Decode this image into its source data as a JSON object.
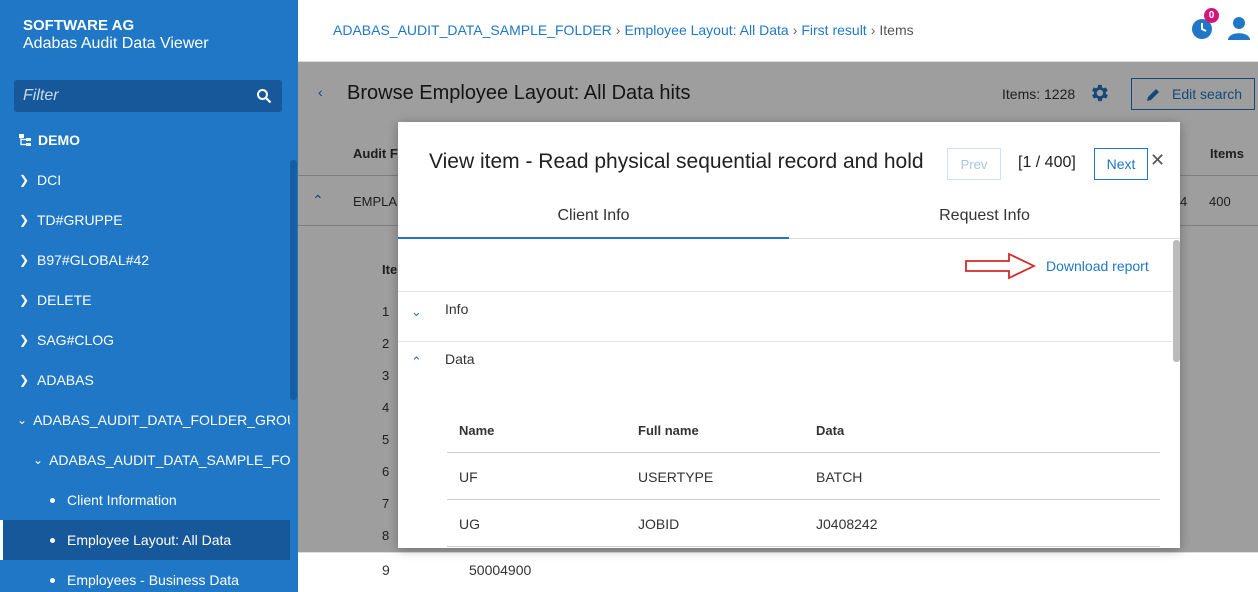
{
  "sidebar": {
    "brand_line1": "SOFTWARE AG",
    "brand_line2": "Adabas Audit Data Viewer",
    "filter_placeholder": "Filter",
    "items": [
      {
        "label": "DEMO"
      },
      {
        "label": "DCI"
      },
      {
        "label": "TD#GRUPPE"
      },
      {
        "label": "B97#GLOBAL#42"
      },
      {
        "label": "DELETE"
      },
      {
        "label": "SAG#CLOG"
      },
      {
        "label": "ADABAS"
      },
      {
        "label": "ADABAS_AUDIT_DATA_FOLDER_GROUP"
      },
      {
        "label": "ADABAS_AUDIT_DATA_SAMPLE_FO..."
      },
      {
        "label": "Client Information"
      },
      {
        "label": "Employee Layout: All Data"
      },
      {
        "label": "Employees - Business Data"
      }
    ]
  },
  "header": {
    "breadcrumb": [
      "ADABAS_AUDIT_DATA_SAMPLE_FOLDER",
      "Employee Layout: All Data",
      "First result",
      "Items"
    ],
    "notification_count": "0"
  },
  "main": {
    "title": "Browse Employee Layout: All Data hits",
    "items_count": "Items: 1228",
    "edit_search": "Edit search",
    "col_audit": "Audit F",
    "col_items": "Items",
    "row_audit": "EMPLA",
    "row_num": "4",
    "row_items": "400",
    "sub_head": "Ite",
    "sub_rows": [
      "1",
      "2",
      "3",
      "4",
      "5",
      "6",
      "7",
      "8"
    ],
    "last_row_num": "9",
    "last_row_val": "50004900"
  },
  "modal": {
    "title": "View item - Read physical sequential record and hold",
    "prev": "Prev",
    "pager": "[1 / 400]",
    "next": "Next",
    "close": "✕",
    "tabs": [
      "Client Info",
      "Request Info"
    ],
    "download": "Download report",
    "sections": {
      "info": "Info",
      "data": "Data"
    },
    "table": {
      "headers": [
        "Name",
        "Full name",
        "Data"
      ],
      "rows": [
        [
          "UF",
          "USERTYPE",
          "BATCH"
        ],
        [
          "UG",
          "JOBID",
          "J0408242"
        ]
      ]
    }
  },
  "colors": {
    "primary": "#1f77c6",
    "sidebar_dark": "#17589a",
    "badge": "#d4157c",
    "arrow": "#d62828"
  }
}
